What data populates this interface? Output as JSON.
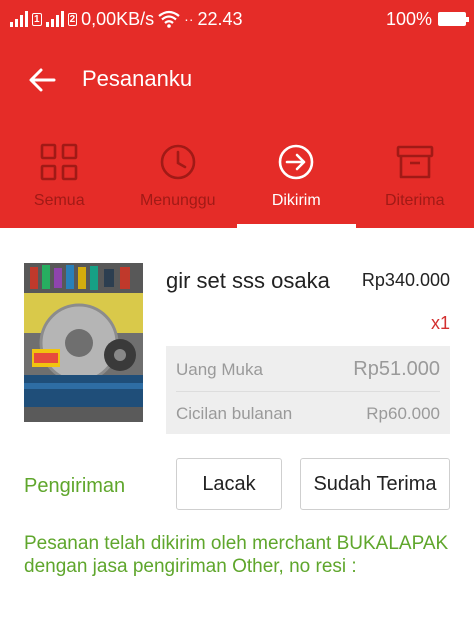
{
  "status_bar": {
    "net_speed": "0,00KB/s",
    "time": "22.43",
    "battery": "100%",
    "icons": [
      "signal-icon",
      "signal-icon",
      "wifi-icon",
      "battery-icon"
    ]
  },
  "app_bar": {
    "title": "Pesananku",
    "back_icon": "arrow-left-icon"
  },
  "tabs": [
    {
      "label": "Semua",
      "icon": "grid-icon",
      "active": false
    },
    {
      "label": "Menunggu",
      "icon": "clock-icon",
      "active": false
    },
    {
      "label": "Dikirim",
      "icon": "arrow-circle-icon",
      "active": true
    },
    {
      "label": "Diterima",
      "icon": "box-icon",
      "active": false
    }
  ],
  "order": {
    "product_name": "gir set sss osaka",
    "price": "Rp340.000",
    "quantity": "x1",
    "payment": {
      "down_payment_label": "Uang Muka",
      "down_payment_value": "Rp51.000",
      "installment_label": "Cicilan bulanan",
      "installment_value": "Rp60.000"
    }
  },
  "shipping": {
    "label": "Pengiriman",
    "track_button": "Lacak",
    "received_button": "Sudah Terima",
    "notice": "Pesanan telah dikirim oleh merchant BUKALAPAK dengan jasa pengiriman Other, no resi :"
  },
  "colors": {
    "brand_red": "#e52c28",
    "tab_inactive": "#a11a16",
    "green_text": "#5fa62c",
    "quantity_red": "#d32f2f"
  }
}
